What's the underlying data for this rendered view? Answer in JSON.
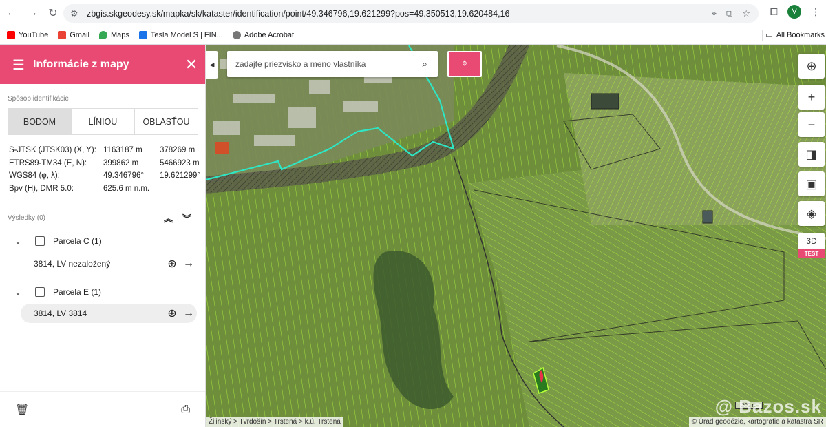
{
  "browser": {
    "url": "zbgis.skgeodesy.sk/mapka/sk/kataster/identification/point/49.346796,19.621299?pos=49.350513,19.620484,16",
    "avatar_letter": "V",
    "bookmarks": [
      {
        "label": "YouTube",
        "color": "#ff0000"
      },
      {
        "label": "Gmail",
        "color": "#ea4335"
      },
      {
        "label": "Maps",
        "color": "#34a853"
      },
      {
        "label": "Tesla Model S | FIN...",
        "color": "#1a73e8"
      },
      {
        "label": "Adobe Acrobat",
        "color": "#555555"
      }
    ],
    "all_bookmarks": "All Bookmarks"
  },
  "panel": {
    "title": "Informácie z mapy",
    "identification_label": "Spôsob identifikácie",
    "modes": [
      "BODOM",
      "LÍNIOU",
      "OBLASŤOU"
    ],
    "active_mode": 0,
    "coords": [
      {
        "label": "S-JTSK (JTSK03) (X, Y):",
        "v1": "1163187 m",
        "v2": "378269 m"
      },
      {
        "label": "ETRS89-TM34 (E, N):",
        "v1": "399862 m",
        "v2": "5466923 m"
      },
      {
        "label": "WGS84 (φ, λ):",
        "v1": "49.346796°",
        "v2": "19.621299°"
      },
      {
        "label": "Bpv (H), DMR 5.0:",
        "v1": "625.6 m n.m.",
        "v2": ""
      }
    ],
    "results_label": "Výsledky (0)",
    "groups": [
      {
        "label": "Parcela C (1)",
        "item": "3814, LV nezaložený"
      },
      {
        "label": "Parcela E (1)",
        "item": "3814, LV 3814"
      }
    ]
  },
  "map": {
    "search_placeholder": "zadajte priezvisko a meno vlastníka",
    "btn_3d": "3D",
    "test_badge": "TEST",
    "breadcrumb": "Žilinský > Tvrdošín > Trstená > k.ú. Trstená",
    "attribution": "© Úrad geodézie, kartografie a katastra SR",
    "scale": "200 m",
    "watermark": "@ Bazos.sk"
  },
  "colors": {
    "brand": "#e84a73",
    "parcel_lines": "#b6ff3a",
    "boundary": "#2ee6c4"
  }
}
